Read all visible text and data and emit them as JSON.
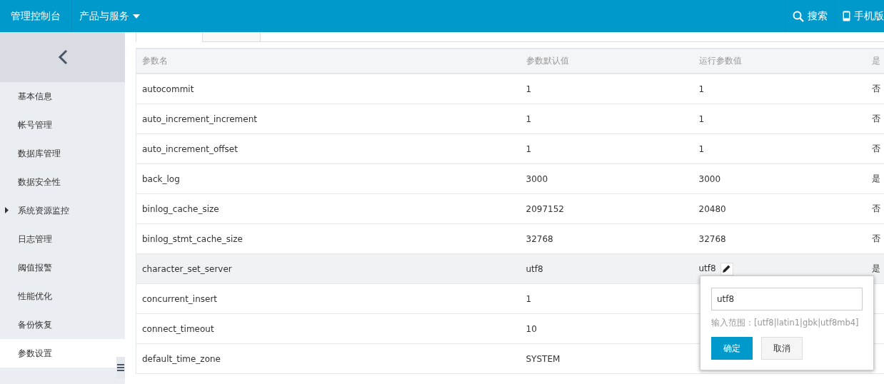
{
  "topbar": {
    "console": "管理控制台",
    "products": "产品与服务",
    "search": "搜索",
    "mobile": "手机版"
  },
  "sidebar": {
    "items": [
      {
        "label": "基本信息",
        "selected": false,
        "expandable": false
      },
      {
        "label": "帐号管理",
        "selected": false,
        "expandable": false
      },
      {
        "label": "数据库管理",
        "selected": false,
        "expandable": false
      },
      {
        "label": "数据安全性",
        "selected": false,
        "expandable": false
      },
      {
        "label": "系统资源监控",
        "selected": false,
        "expandable": true
      },
      {
        "label": "日志管理",
        "selected": false,
        "expandable": false
      },
      {
        "label": "阈值报警",
        "selected": false,
        "expandable": false
      },
      {
        "label": "性能优化",
        "selected": false,
        "expandable": false
      },
      {
        "label": "备份恢复",
        "selected": false,
        "expandable": false
      },
      {
        "label": "参数设置",
        "selected": true,
        "expandable": false
      }
    ]
  },
  "tabs": [
    {
      "selected": true
    },
    {
      "selected": false
    }
  ],
  "table": {
    "columns": [
      "参数名",
      "参数默认值",
      "运行参数值",
      "是"
    ],
    "rows": [
      {
        "name": "autocommit",
        "default": "1",
        "running": "1",
        "column_4": "否",
        "highlighted": false,
        "editable": false
      },
      {
        "name": "auto_increment_increment",
        "default": "1",
        "running": "1",
        "column_4": "否",
        "highlighted": false,
        "editable": false
      },
      {
        "name": "auto_increment_offset",
        "default": "1",
        "running": "1",
        "column_4": "否",
        "highlighted": false,
        "editable": false
      },
      {
        "name": "back_log",
        "default": "3000",
        "running": "3000",
        "column_4": "是",
        "highlighted": false,
        "editable": false
      },
      {
        "name": "binlog_cache_size",
        "default": "2097152",
        "running": "20480",
        "column_4": "否",
        "highlighted": false,
        "editable": false
      },
      {
        "name": "binlog_stmt_cache_size",
        "default": "32768",
        "running": "32768",
        "column_4": "否",
        "highlighted": false,
        "editable": false
      },
      {
        "name": "character_set_server",
        "default": "utf8",
        "running": "utf8",
        "column_4": "是",
        "highlighted": true,
        "editable": true
      },
      {
        "name": "concurrent_insert",
        "default": "1",
        "highlighted": false
      },
      {
        "name": "connect_timeout",
        "default": "10",
        "highlighted": false
      },
      {
        "name": "default_time_zone",
        "default": "SYSTEM",
        "highlighted": false
      }
    ]
  },
  "popover": {
    "value": "utf8",
    "hint": "输入范围：[utf8|latin1|gbk|utf8mb4]",
    "confirm": "确定",
    "cancel": "取消"
  }
}
